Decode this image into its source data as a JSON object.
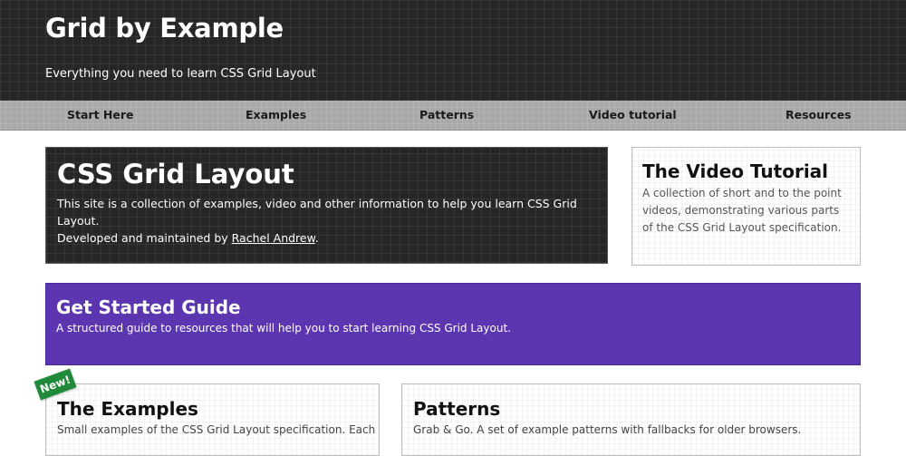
{
  "header": {
    "title": "Grid by Example",
    "tagline": "Everything you need to learn CSS Grid Layout"
  },
  "nav": {
    "items": [
      {
        "label": "Start Here"
      },
      {
        "label": "Examples"
      },
      {
        "label": "Patterns"
      },
      {
        "label": "Video tutorial"
      },
      {
        "label": "Resources"
      }
    ]
  },
  "hero": {
    "title": "CSS Grid Layout",
    "line1": "This site is a collection of examples, video and other information to help you learn CSS Grid Layout.",
    "line2_prefix": "Developed and maintained by ",
    "author_link": "Rachel Andrew",
    "line2_suffix": "."
  },
  "video_card": {
    "title": "The Video Tutorial",
    "text": "A collection of short and to the point videos, demonstrating various parts of the CSS Grid Layout specification."
  },
  "guide_card": {
    "title": "Get Started Guide",
    "text": "A structured guide to resources that will help you to start learning CSS Grid Layout."
  },
  "examples_card": {
    "badge": "New!",
    "title": "The Examples",
    "text": "Small examples of the CSS Grid Layout specification. Each"
  },
  "patterns_card": {
    "title": "Patterns",
    "text": "Grab & Go. A set of example patterns with fallbacks for older browsers."
  },
  "colors": {
    "header_bg": "#262626",
    "nav_bg": "#a9a9a9",
    "guide_bg": "#5b36b0",
    "badge_bg": "#1f8a3a"
  }
}
